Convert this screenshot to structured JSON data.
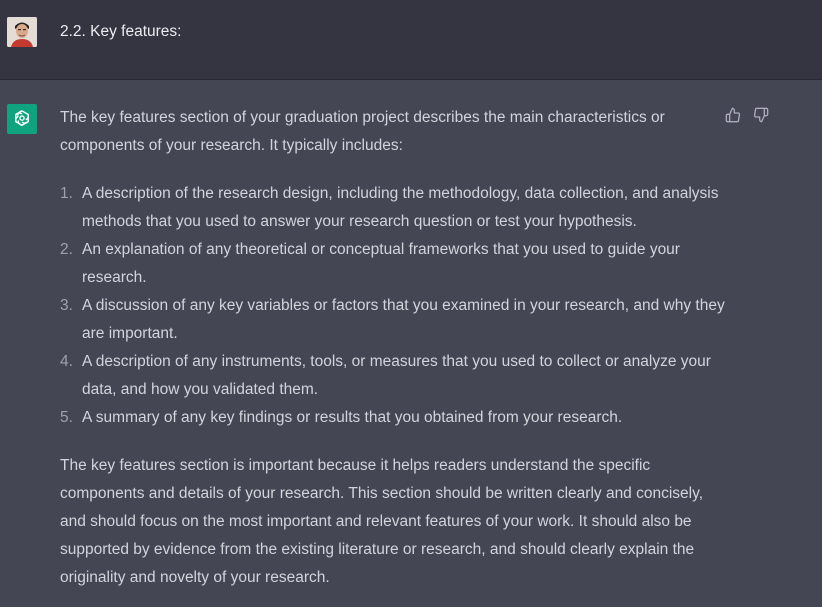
{
  "user_message": {
    "avatar": "user-photo-avatar",
    "text": "2.2.  Key features:"
  },
  "assistant_message": {
    "avatar": "openai-logo-icon",
    "intro": "The key features section of your graduation project describes the main characteristics or components of your research. It typically includes:",
    "items": [
      {
        "num": "1.",
        "text": "A description of the research design, including the methodology, data collection, and analysis methods that you used to answer your research question or test your hypothesis."
      },
      {
        "num": "2.",
        "text": "An explanation of any theoretical or conceptual frameworks that you used to guide your research."
      },
      {
        "num": "3.",
        "text": "A discussion of any key variables or factors that you examined in your research, and why they are important."
      },
      {
        "num": "4.",
        "text": "A description of any instruments, tools, or measures that you used to collect or analyze your data, and how you validated them."
      },
      {
        "num": "5.",
        "text": "A summary of any key findings or results that you obtained from your research."
      }
    ],
    "conclusion": "The key features section is important because it helps readers understand the specific components and details of your research. This section should be written clearly and concisely, and should focus on the most important and relevant features of your work. It should also be supported by evidence from the existing literature or research, and should clearly explain the originality and novelty of your research."
  },
  "feedback": {
    "thumbs_up": "thumbs-up-icon",
    "thumbs_down": "thumbs-down-icon"
  },
  "colors": {
    "user_bg": "#343541",
    "assistant_bg": "#444654",
    "text": "#d1d5db",
    "logo": "#10a37f"
  }
}
